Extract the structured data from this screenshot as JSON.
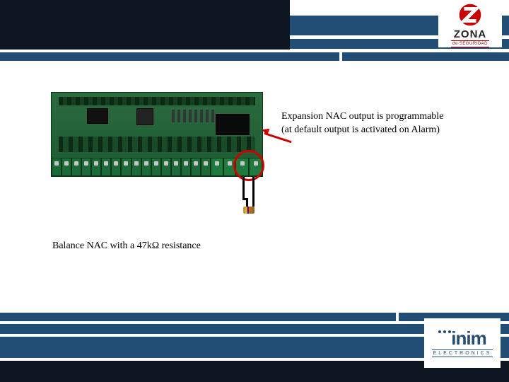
{
  "header_logo": {
    "brand": "ZONA",
    "subtitle": "de SEGURIDAD"
  },
  "callouts": {
    "expansion_line1": "Expansion NAC output is programmable",
    "expansion_line2": "(at default output is activated on Alarm)",
    "balance": "Balance NAC with a 47kΩ resistance"
  },
  "footer_logo": {
    "brand": "inim",
    "subtitle": "ELECTRONICS"
  }
}
